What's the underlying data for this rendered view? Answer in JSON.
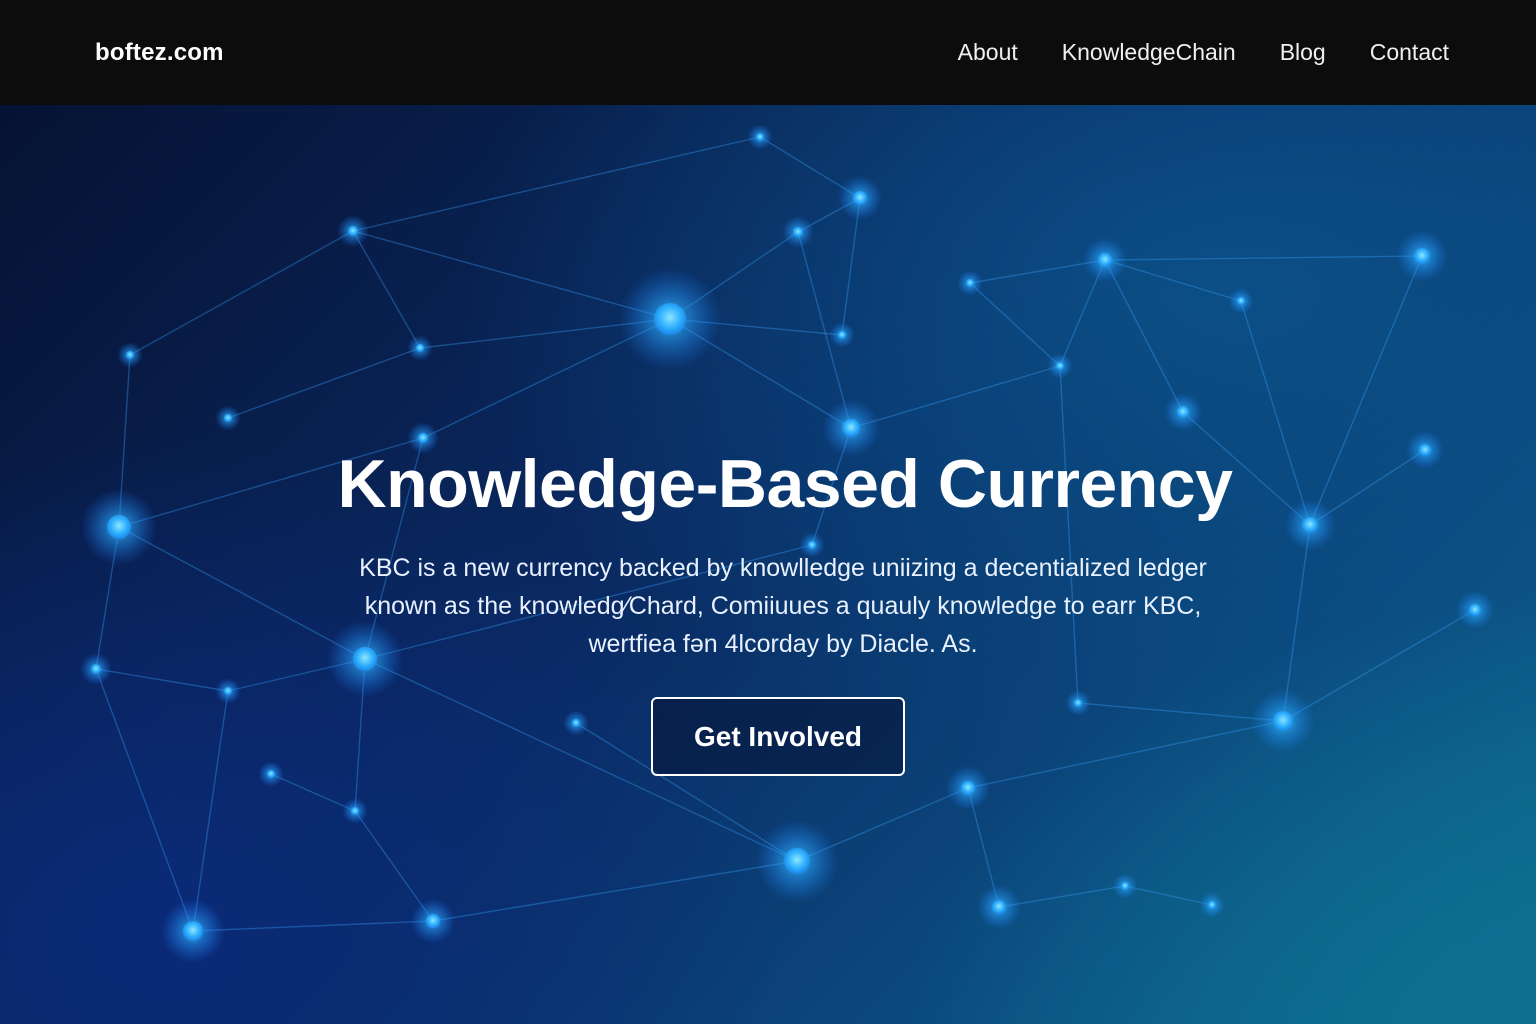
{
  "header": {
    "brand": "boftez.com",
    "nav": [
      {
        "label": "About"
      },
      {
        "label": "KnowledgeChain"
      },
      {
        "label": "Blog"
      },
      {
        "label": "Contact"
      }
    ]
  },
  "hero": {
    "title": "Knowledge-Based Currency",
    "description_lines": [
      "KBC is a new currency backed by knowlledge uniizing a decentialized ledger",
      "known as the knowledg⁄Chard, Comiiuues a quauly knowledge to earr KBC,",
      "wertfiea fən 4lcorday by Diacle. As."
    ],
    "cta_label": "Get Involved"
  },
  "colors": {
    "navbar_bg": "#0c0c0c",
    "hero_dark": "#061233",
    "hero_teal": "#0d6f93",
    "node_glow": "#39b6ff",
    "text": "#ffffff"
  }
}
